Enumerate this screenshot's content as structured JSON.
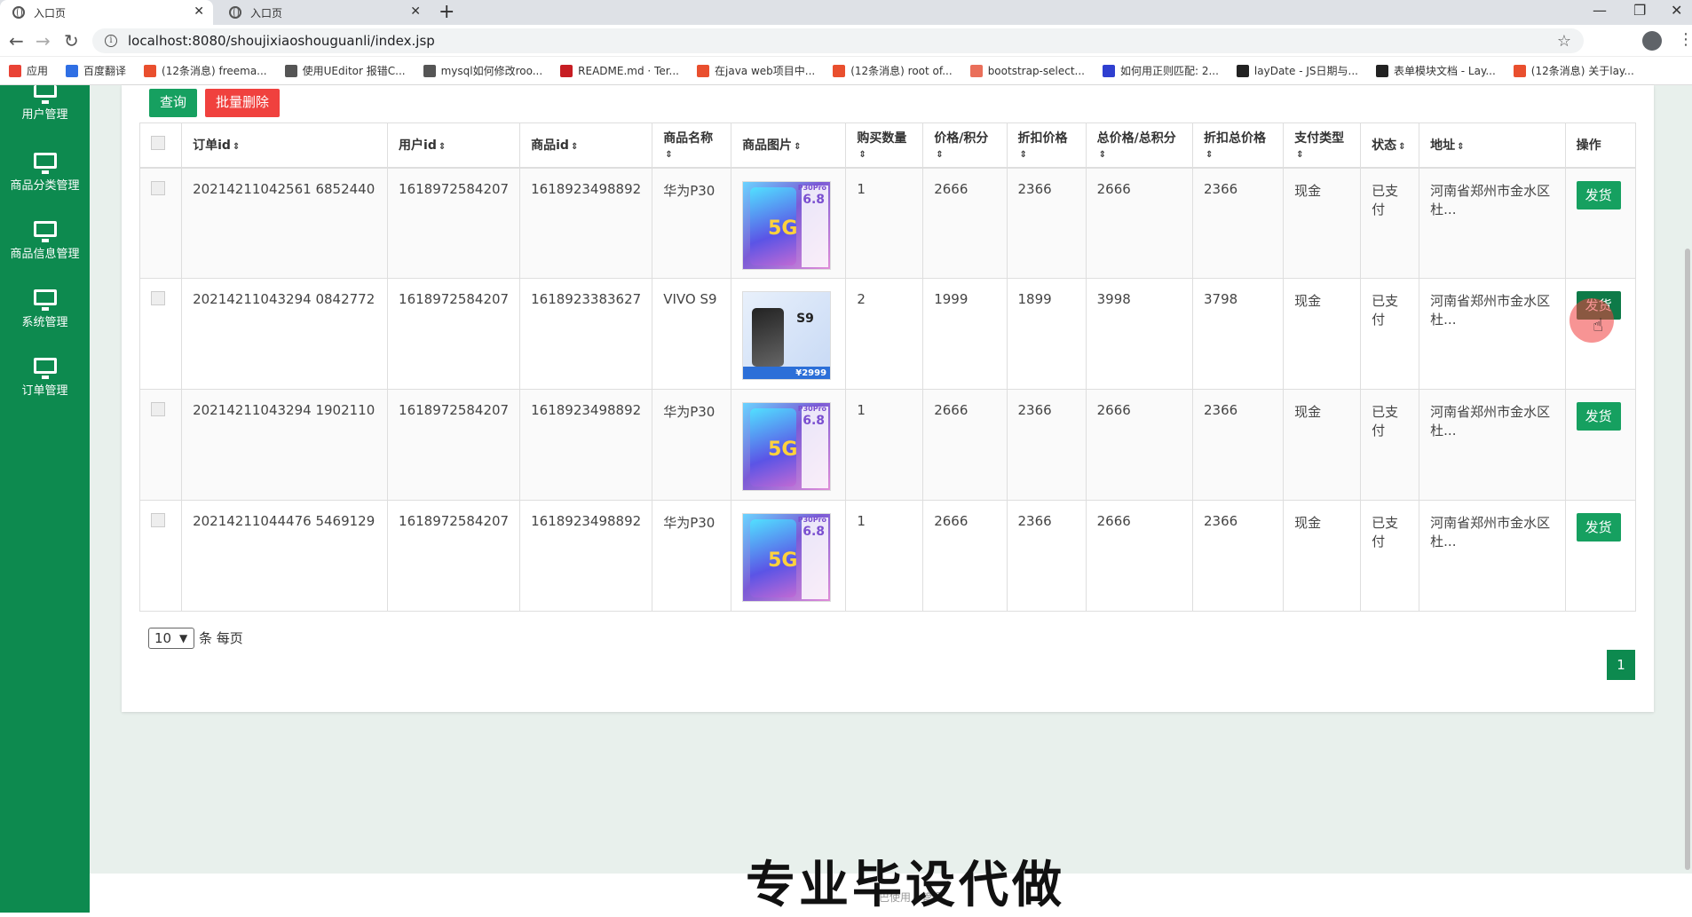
{
  "browser": {
    "tabs": [
      {
        "title": "入口页",
        "active": true
      },
      {
        "title": "入口页",
        "active": false
      }
    ],
    "url": "localhost:8080/shoujixiaoshouguanli/index.jsp",
    "bookmarks": [
      {
        "label": "应用",
        "icon": "apps-grid-icon",
        "color": "#e94235"
      },
      {
        "label": "百度翻译",
        "icon": "baidu-translate-icon",
        "color": "#2f6fe4"
      },
      {
        "label": "(12条消息) freema...",
        "icon": "csdn-icon",
        "color": "#e94f2e"
      },
      {
        "label": "使用UEditor 报错C...",
        "icon": "link-icon",
        "color": "#555555"
      },
      {
        "label": "mysql如何修改roo...",
        "icon": "link-icon",
        "color": "#555555"
      },
      {
        "label": "README.md · Ter...",
        "icon": "gitee-icon",
        "color": "#c71d23"
      },
      {
        "label": "在java web项目中...",
        "icon": "csdn-icon",
        "color": "#e94f2e"
      },
      {
        "label": "(12条消息) root of...",
        "icon": "csdn-icon",
        "color": "#e94f2e"
      },
      {
        "label": "bootstrap-select...",
        "icon": "jianshu-icon",
        "color": "#ea6f5a"
      },
      {
        "label": "如何用正则匹配: 2...",
        "icon": "baidu-paw-icon",
        "color": "#2f3fd0"
      },
      {
        "label": "layDate - JS日期与...",
        "icon": "layui-icon",
        "color": "#222222"
      },
      {
        "label": "表单模块文档 - Lay...",
        "icon": "layui-icon",
        "color": "#222222"
      },
      {
        "label": "(12条消息) 关于lay...",
        "icon": "csdn-icon",
        "color": "#e94f2e"
      }
    ]
  },
  "sidebar": {
    "items": [
      {
        "label": "用户管理",
        "icon": "monitor-icon"
      },
      {
        "label": "商品分类管理",
        "icon": "monitor-icon"
      },
      {
        "label": "商品信息管理",
        "icon": "monitor-icon"
      },
      {
        "label": "系统管理",
        "icon": "monitor-icon"
      },
      {
        "label": "订单管理",
        "icon": "monitor-icon"
      }
    ]
  },
  "toolbar": {
    "query_label": "查询",
    "batch_delete_label": "批量删除"
  },
  "table": {
    "headers": [
      "订单id",
      "用户id",
      "商品id",
      "商品名称",
      "商品图片",
      "购买数量",
      "价格/积分",
      "折扣价格",
      "总价格/总积分",
      "折扣总价格",
      "支付类型",
      "状态",
      "地址",
      "操作"
    ],
    "rows": [
      {
        "order_id": "20214211042561 6852440",
        "user_id": "1618972584207",
        "product_id": "1618923498892",
        "name": "华为P30",
        "image": "p30",
        "qty": "1",
        "price": "2666",
        "discount_price": "2366",
        "total": "2666",
        "discount_total": "2366",
        "pay_type": "现金",
        "status": "已支付",
        "address": "河南省郑州市金水区杜...",
        "action": "发货"
      },
      {
        "order_id": "20214211043294 0842772",
        "user_id": "1618972584207",
        "product_id": "1618923383627",
        "name": "VIVO S9",
        "image": "s9",
        "qty": "2",
        "price": "1999",
        "discount_price": "1899",
        "total": "3998",
        "discount_total": "3798",
        "pay_type": "现金",
        "status": "已支付",
        "address": "河南省郑州市金水区杜...",
        "action": "发货"
      },
      {
        "order_id": "20214211043294 1902110",
        "user_id": "1618972584207",
        "product_id": "1618923498892",
        "name": "华为P30",
        "image": "p30",
        "qty": "1",
        "price": "2666",
        "discount_price": "2366",
        "total": "2666",
        "discount_total": "2366",
        "pay_type": "现金",
        "status": "已支付",
        "address": "河南省郑州市金水区杜...",
        "action": "发货"
      },
      {
        "order_id": "20214211044476 5469129",
        "user_id": "1618972584207",
        "product_id": "1618923498892",
        "name": "华为P30",
        "image": "p30",
        "qty": "1",
        "price": "2666",
        "discount_price": "2366",
        "total": "2666",
        "discount_total": "2366",
        "pay_type": "现金",
        "status": "已支付",
        "address": "河南省郑州市金水区杜...",
        "action": "发货"
      }
    ]
  },
  "pagination": {
    "page_size": "10",
    "per_page_label": "条 每页",
    "current_page": "1"
  },
  "thumb_text": {
    "p30_model": "P30Pro",
    "p30_price": "6.8",
    "p30_5g": "5G",
    "s9_model": "S9",
    "s9_price": "¥2999"
  },
  "watermark": "专业毕设代做",
  "footer_text": "巴使用…管理",
  "colors": {
    "sidebar": "#0d8a4f",
    "primary_button": "#16a060",
    "danger_button": "#f0413e"
  }
}
